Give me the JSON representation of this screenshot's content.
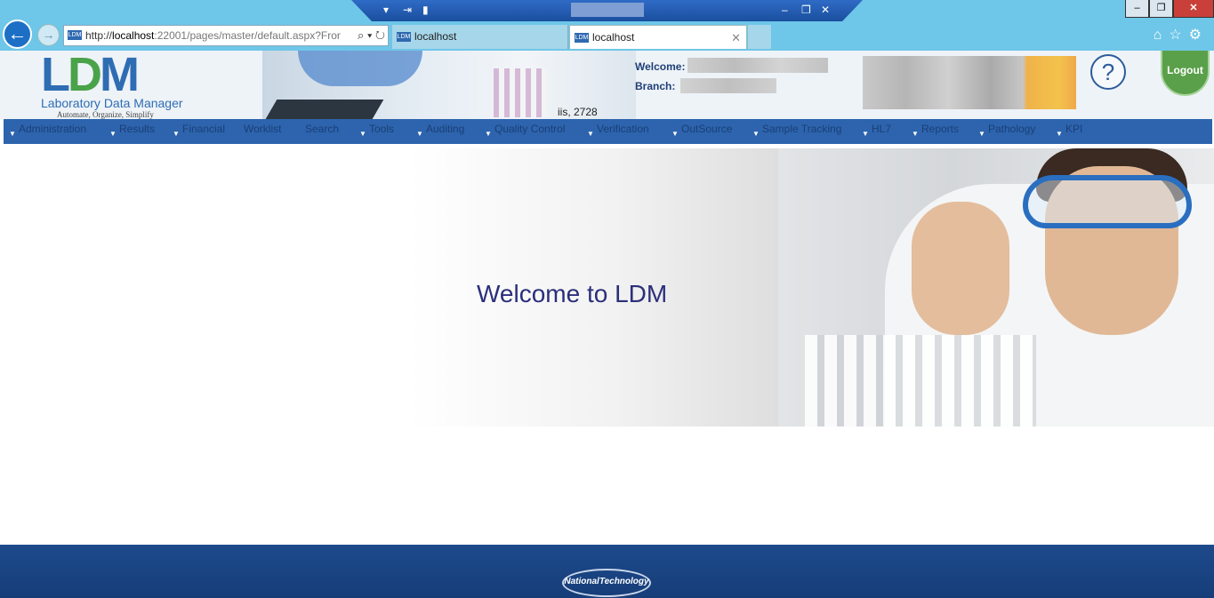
{
  "browser": {
    "url_prefix": "http://",
    "url_host": "localhost",
    "url_rest": ":22001/pages/master/default.aspx?Fror",
    "tabs": [
      {
        "label": "localhost",
        "active": false
      },
      {
        "label": "localhost",
        "active": true
      }
    ],
    "favicon_text": "LDM",
    "accent_color": "#6ec6e8"
  },
  "header": {
    "logo_letters": {
      "l": "L",
      "d": "D",
      "m": "M"
    },
    "logo_name": "Laboratory Data Manager",
    "logo_tagline": "Automate, Organize, Simplify",
    "welcome_label": "Welcome:",
    "branch_label": "Branch:",
    "server_info": "iis, 2728",
    "help_symbol": "?",
    "logout_label": "Logout"
  },
  "menu": {
    "items": [
      {
        "label": "Administration",
        "dropdown": true
      },
      {
        "label": "Results",
        "dropdown": true
      },
      {
        "label": "Financial",
        "dropdown": true
      },
      {
        "label": "Worklist",
        "dropdown": false
      },
      {
        "label": "Search",
        "dropdown": false
      },
      {
        "label": "Tools",
        "dropdown": true
      },
      {
        "label": "Auditing",
        "dropdown": true
      },
      {
        "label": "Quality Control",
        "dropdown": true
      },
      {
        "label": "Verification",
        "dropdown": true
      },
      {
        "label": "OutSource",
        "dropdown": true
      },
      {
        "label": "Sample Tracking",
        "dropdown": true
      },
      {
        "label": "HL7",
        "dropdown": true
      },
      {
        "label": "Reports",
        "dropdown": true
      },
      {
        "label": "Pathology",
        "dropdown": true
      },
      {
        "label": "KPI",
        "dropdown": true
      }
    ],
    "bar_color": "#2d64ad"
  },
  "hero": {
    "title": "Welcome to LDM"
  },
  "footer": {
    "brand": "NationalTechnology"
  }
}
